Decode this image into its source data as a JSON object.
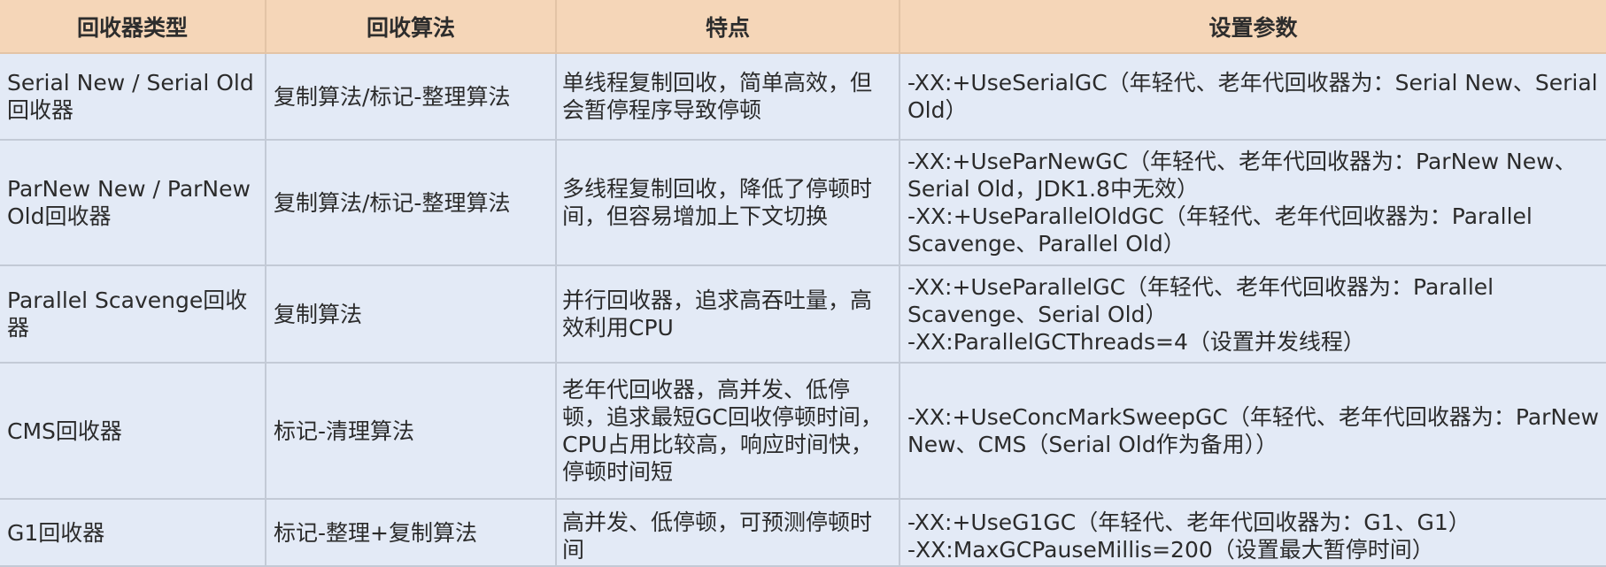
{
  "table": {
    "headers": [
      "回收器类型",
      "回收算法",
      "特点",
      "设置参数"
    ],
    "rows": [
      {
        "name": "Serial New / Serial Old回收器",
        "algorithm": "复制算法/标记-整理算法",
        "feature": "单线程复制回收，简单高效，但会暂停程序导致停顿",
        "setting": "-XX:+UseSerialGC（年轻代、老年代回收器为：Serial New、Serial Old）"
      },
      {
        "name": "ParNew New / ParNew Old回收器",
        "algorithm": "复制算法/标记-整理算法",
        "feature": "多线程复制回收，降低了停顿时间，但容易增加上下文切换",
        "setting": "-XX:+UseParNewGC（年轻代、老年代回收器为：ParNew New、Serial Old，JDK1.8中无效）\n-XX:+UseParallelOldGC（年轻代、老年代回收器为：Parallel Scavenge、Parallel Old）"
      },
      {
        "name": "Parallel Scavenge回收器",
        "algorithm": "复制算法",
        "feature": "并行回收器，追求高吞吐量，高效利用CPU",
        "setting": "-XX:+UseParallelGC（年轻代、老年代回收器为：Parallel Scavenge、Serial Old）\n-XX:ParallelGCThreads=4（设置并发线程）"
      },
      {
        "name": "CMS回收器",
        "algorithm": "标记-清理算法",
        "feature": "老年代回收器，高并发、低停顿，追求最短GC回收停顿时间，CPU占用比较高，响应时间快，停顿时间短",
        "setting": "-XX:+UseConcMarkSweepGC（年轻代、老年代回收器为：ParNew New、CMS（Serial Old作为备用））"
      },
      {
        "name": "G1回收器",
        "algorithm": "标记-整理+复制算法",
        "feature": "高并发、低停顿，可预测停顿时间",
        "setting": "-XX:+UseG1GC（年轻代、老年代回收器为：G1、G1）\n-XX:MaxGCPauseMillis=200（设置最大暂停时间）"
      }
    ]
  }
}
